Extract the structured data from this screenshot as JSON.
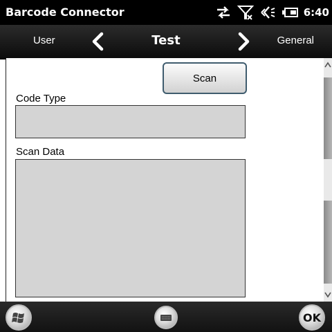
{
  "app": {
    "title": "Barcode Connector",
    "clock": "6:40"
  },
  "status_icons": [
    "sync-arrows-icon",
    "no-signal-icon",
    "volume-icon",
    "battery-icon"
  ],
  "tabs": {
    "previous": "User",
    "current": "Test",
    "next": "General"
  },
  "form": {
    "scan_button": "Scan",
    "code_type_label": "Code Type",
    "code_type_value": "",
    "scan_data_label": "Scan Data",
    "scan_data_value": ""
  },
  "bottom_bar": {
    "ok_label": "OK",
    "start_icon": "windows-start-icon",
    "keyboard_icon": "keyboard-icon"
  },
  "colors": {
    "background": "#ffffff",
    "field_fill": "#d4d4d4",
    "bar": "#000000"
  }
}
